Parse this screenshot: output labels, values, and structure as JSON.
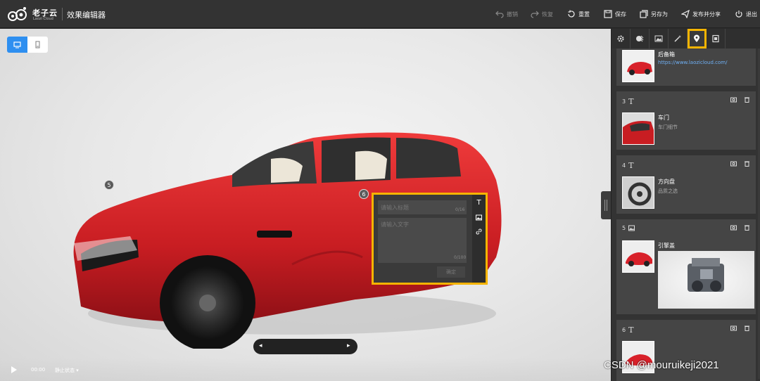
{
  "brand": {
    "name": "老子云",
    "sub": "Laozi Cloud",
    "app_title": "效果编辑器"
  },
  "toolbar": {
    "undo": "撤销",
    "redo": "恢复",
    "reset": "重置",
    "save": "保存",
    "save_as": "另存为",
    "publish": "发布并分享",
    "exit": "退出"
  },
  "viewport": {
    "hotspots": [
      "5",
      "6"
    ],
    "editor": {
      "title_placeholder": "请输入标题",
      "title_count": "0/16",
      "text_placeholder": "请输入文字",
      "text_count": "0/100",
      "confirm": "确定"
    },
    "nav_prev": "◂",
    "nav_next": "▸",
    "time": "00:00",
    "state": "静止状态 ▾"
  },
  "panel": {
    "active_tab": "hotspot",
    "cards": [
      {
        "index": "",
        "name": "后备箱",
        "sub": "",
        "link": "https://www.laozicloud.com/"
      },
      {
        "index": "3",
        "type": "T",
        "name": "车门",
        "sub": "车门细节"
      },
      {
        "index": "4",
        "type": "T",
        "name": "方向盘",
        "sub": "品质之选"
      },
      {
        "index": "5",
        "type": "image",
        "name": "引擎盖",
        "sub": ""
      },
      {
        "index": "6",
        "type": "T",
        "name": "",
        "sub": ""
      }
    ]
  },
  "watermark": "CSDN @mouruikeji2021",
  "colors": {
    "accent_blue": "#2e8ff0",
    "highlight": "#f5b400",
    "car_red": "#d8212a"
  }
}
